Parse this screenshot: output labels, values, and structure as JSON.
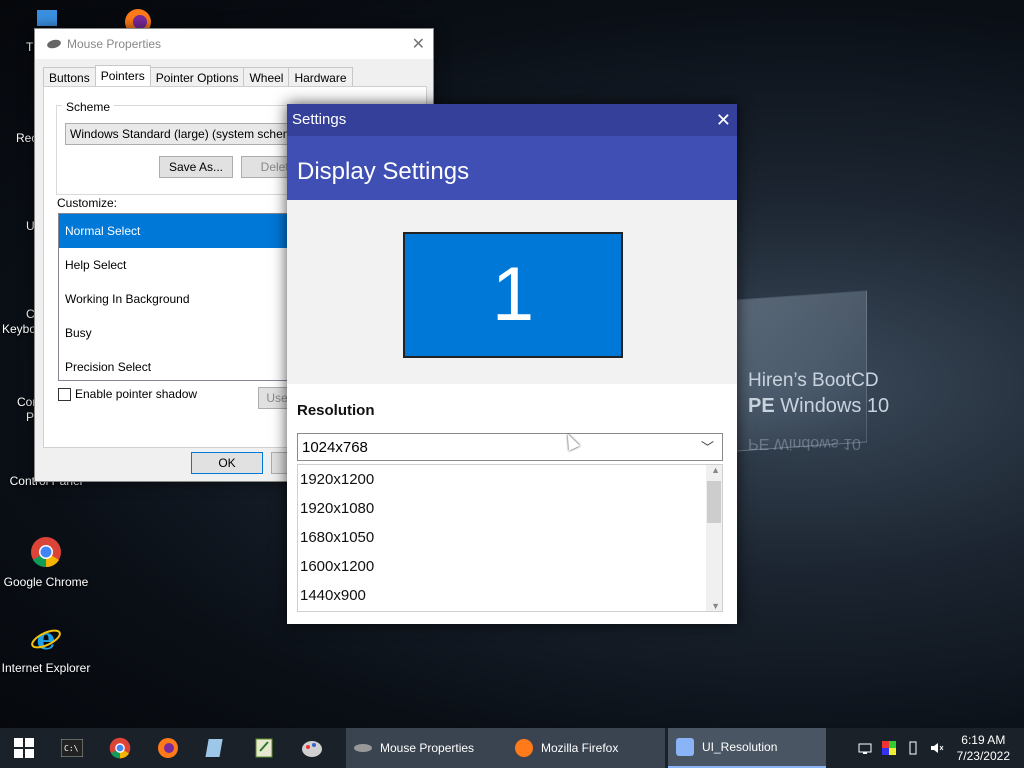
{
  "desktop": {
    "icons": [
      {
        "label": "Control Panel",
        "name": "control-panel"
      },
      {
        "label": "Google Chrome",
        "name": "google-chrome"
      },
      {
        "label": "Internet Explorer",
        "name": "internet-explorer"
      }
    ],
    "partial_labels": [
      "Th",
      "Rec",
      "U",
      "C",
      "Keybo",
      "Con",
      "Pr"
    ],
    "wallpaper": {
      "line1": "Hiren’s BootCD",
      "line2_bold": "PE",
      "line2_rest": " Windows 10",
      "reflection": "PE Windows 10"
    }
  },
  "mouse_properties": {
    "title": "Mouse Properties",
    "tabs": [
      "Buttons",
      "Pointers",
      "Pointer Options",
      "Wheel",
      "Hardware"
    ],
    "active_tab": "Pointers",
    "scheme_label": "Scheme",
    "scheme_value": "Windows Standard (large) (system scheme)",
    "save_as": "Save As...",
    "delete": "Delete",
    "customize_label": "Customize:",
    "cursors": [
      "Normal Select",
      "Help Select",
      "Working In Background",
      "Busy",
      "Precision Select"
    ],
    "selected_cursor": "Normal Select",
    "shadow_label": "Enable pointer shadow",
    "use_default": "Use",
    "ok": "OK"
  },
  "settings": {
    "title": "Settings",
    "header": "Display Settings",
    "monitor_number": "1",
    "resolution_label": "Resolution",
    "resolution_value": "1024x768",
    "options": [
      "1920x1200",
      "1920x1080",
      "1680x1050",
      "1600x1200",
      "1440x900"
    ],
    "accent": "#3f4fb3",
    "monitor_color": "#0078d7"
  },
  "taskbar": {
    "tasks": [
      {
        "label": "Mouse Properties"
      },
      {
        "label": "Mozilla Firefox"
      },
      {
        "label": "UI_Resolution"
      }
    ],
    "time": "6:19 AM",
    "date": "7/23/2022"
  }
}
